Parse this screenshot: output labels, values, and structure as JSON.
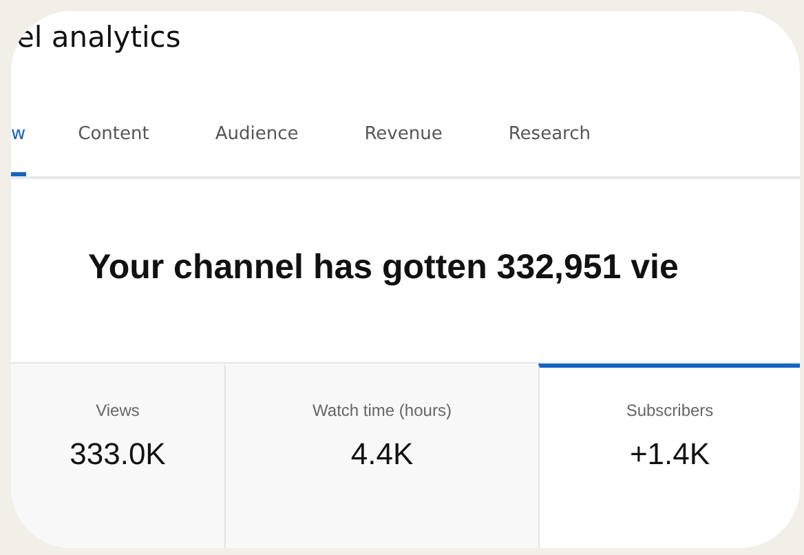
{
  "header": {
    "title": "el analytics"
  },
  "tabs": [
    {
      "label": "w",
      "selected": true
    },
    {
      "label": "Content",
      "selected": false
    },
    {
      "label": "Audience",
      "selected": false
    },
    {
      "label": "Revenue",
      "selected": false
    },
    {
      "label": "Research",
      "selected": false
    }
  ],
  "headline": "Your channel has gotten 332,951 vie",
  "metrics": [
    {
      "label": "Views",
      "value": "333.0K",
      "selected": false
    },
    {
      "label": "Watch time (hours)",
      "value": "4.4K",
      "selected": false
    },
    {
      "label": "Subscribers",
      "value": "+1.4K",
      "selected": true
    }
  ]
}
